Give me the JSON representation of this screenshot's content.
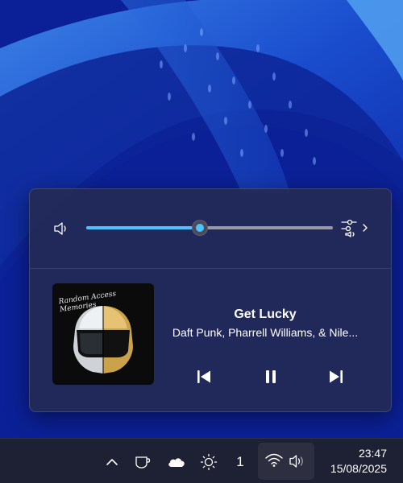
{
  "volume": {
    "level_fraction": 0.46
  },
  "now_playing": {
    "title": "Get Lucky",
    "artist": "Daft Punk, Pharrell Williams, & Nile...",
    "album_art_text": "Random Access Memories"
  },
  "taskbar": {
    "notification_count": "1",
    "time": "23:47",
    "date": "15/08/2025"
  },
  "colors": {
    "accent": "#4cc2ff",
    "flyout_bg": "#242a56",
    "taskbar_bg": "#1e2033"
  },
  "icons": {
    "volume": "speaker-icon",
    "mixer": "sound-mixer-icon",
    "previous": "previous-track-icon",
    "pause": "pause-icon",
    "next": "next-track-icon",
    "tray": [
      "chevron-up-icon",
      "cup-icon",
      "cloud-icon",
      "brightness-icon",
      "wifi-icon",
      "speaker-icon"
    ]
  }
}
